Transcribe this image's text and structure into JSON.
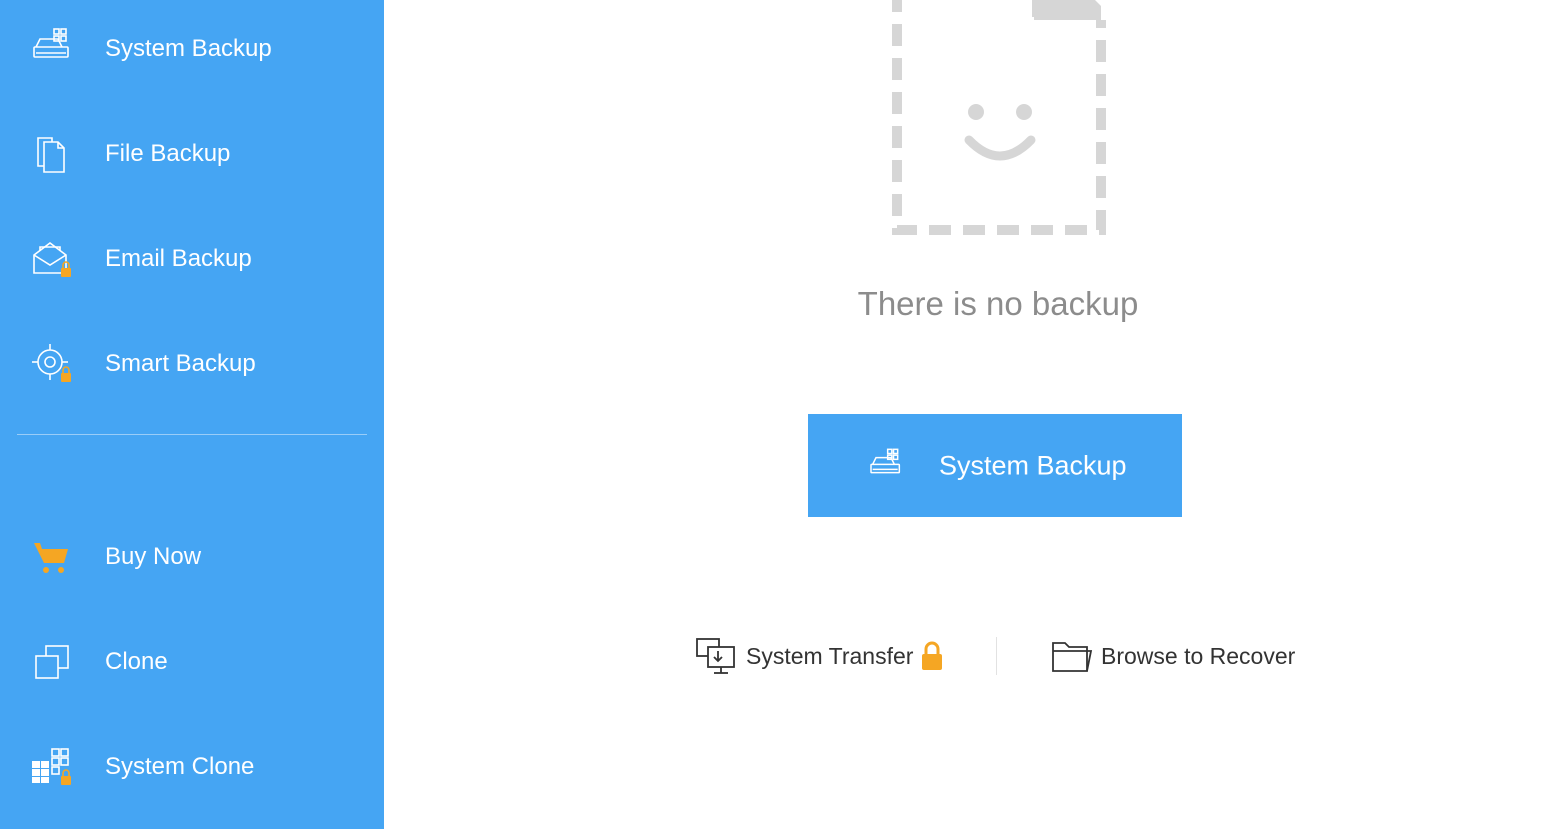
{
  "sidebar": {
    "items": [
      {
        "label": "System Backup",
        "icon": "system-backup-icon"
      },
      {
        "label": "File Backup",
        "icon": "file-backup-icon"
      },
      {
        "label": "Email Backup",
        "icon": "email-backup-icon",
        "locked": true
      },
      {
        "label": "Smart Backup",
        "icon": "smart-backup-icon",
        "locked": true
      },
      {
        "label": "Buy Now",
        "icon": "cart-icon"
      },
      {
        "label": "Clone",
        "icon": "clone-icon"
      },
      {
        "label": "System Clone",
        "icon": "system-clone-icon",
        "locked": true
      }
    ]
  },
  "main": {
    "empty_message": "There is no backup",
    "primary_button_label": "System Backup",
    "links": {
      "system_transfer": "System Transfer",
      "browse_to_recover": "Browse to Recover"
    }
  },
  "colors": {
    "sidebar_bg": "#45a5f3",
    "accent": "#45a5f3",
    "lock": "#f5a623",
    "cart": "#f5a623",
    "placeholder_gray": "#d6d6d6"
  }
}
